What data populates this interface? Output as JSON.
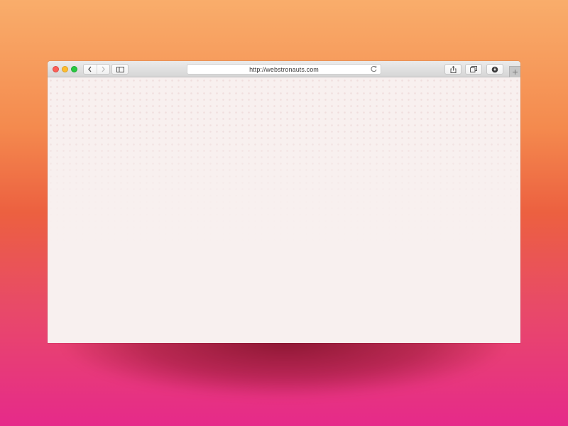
{
  "browser": {
    "url": "http://webstronauts.com",
    "icons": {
      "back": "chevron-left-icon",
      "forward": "chevron-right-icon",
      "sidebar": "sidebar-icon",
      "reload": "reload-icon",
      "share": "share-icon",
      "tabs": "tabs-icon",
      "extension": "extension-icon",
      "new_tab": "plus-icon"
    }
  },
  "colors": {
    "close": "#fc5f57",
    "minimize": "#fdbc2e",
    "maximize": "#28c840",
    "page_background": "#f8f0ef"
  }
}
